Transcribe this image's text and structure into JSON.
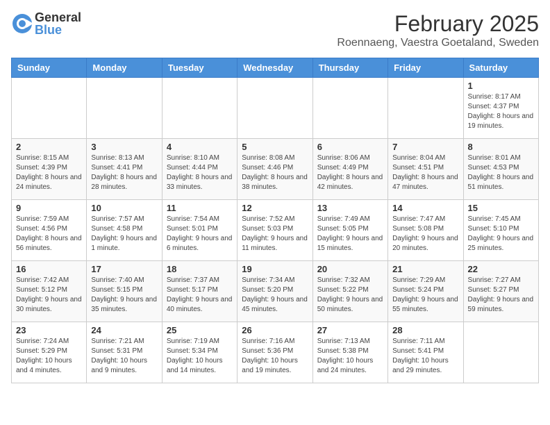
{
  "header": {
    "logo_general": "General",
    "logo_blue": "Blue",
    "month_title": "February 2025",
    "location": "Roennaeng, Vaestra Goetaland, Sweden"
  },
  "weekdays": [
    "Sunday",
    "Monday",
    "Tuesday",
    "Wednesday",
    "Thursday",
    "Friday",
    "Saturday"
  ],
  "weeks": [
    [
      {
        "day": "",
        "info": ""
      },
      {
        "day": "",
        "info": ""
      },
      {
        "day": "",
        "info": ""
      },
      {
        "day": "",
        "info": ""
      },
      {
        "day": "",
        "info": ""
      },
      {
        "day": "",
        "info": ""
      },
      {
        "day": "1",
        "info": "Sunrise: 8:17 AM\nSunset: 4:37 PM\nDaylight: 8 hours and 19 minutes."
      }
    ],
    [
      {
        "day": "2",
        "info": "Sunrise: 8:15 AM\nSunset: 4:39 PM\nDaylight: 8 hours and 24 minutes."
      },
      {
        "day": "3",
        "info": "Sunrise: 8:13 AM\nSunset: 4:41 PM\nDaylight: 8 hours and 28 minutes."
      },
      {
        "day": "4",
        "info": "Sunrise: 8:10 AM\nSunset: 4:44 PM\nDaylight: 8 hours and 33 minutes."
      },
      {
        "day": "5",
        "info": "Sunrise: 8:08 AM\nSunset: 4:46 PM\nDaylight: 8 hours and 38 minutes."
      },
      {
        "day": "6",
        "info": "Sunrise: 8:06 AM\nSunset: 4:49 PM\nDaylight: 8 hours and 42 minutes."
      },
      {
        "day": "7",
        "info": "Sunrise: 8:04 AM\nSunset: 4:51 PM\nDaylight: 8 hours and 47 minutes."
      },
      {
        "day": "8",
        "info": "Sunrise: 8:01 AM\nSunset: 4:53 PM\nDaylight: 8 hours and 51 minutes."
      }
    ],
    [
      {
        "day": "9",
        "info": "Sunrise: 7:59 AM\nSunset: 4:56 PM\nDaylight: 8 hours and 56 minutes."
      },
      {
        "day": "10",
        "info": "Sunrise: 7:57 AM\nSunset: 4:58 PM\nDaylight: 9 hours and 1 minute."
      },
      {
        "day": "11",
        "info": "Sunrise: 7:54 AM\nSunset: 5:01 PM\nDaylight: 9 hours and 6 minutes."
      },
      {
        "day": "12",
        "info": "Sunrise: 7:52 AM\nSunset: 5:03 PM\nDaylight: 9 hours and 11 minutes."
      },
      {
        "day": "13",
        "info": "Sunrise: 7:49 AM\nSunset: 5:05 PM\nDaylight: 9 hours and 15 minutes."
      },
      {
        "day": "14",
        "info": "Sunrise: 7:47 AM\nSunset: 5:08 PM\nDaylight: 9 hours and 20 minutes."
      },
      {
        "day": "15",
        "info": "Sunrise: 7:45 AM\nSunset: 5:10 PM\nDaylight: 9 hours and 25 minutes."
      }
    ],
    [
      {
        "day": "16",
        "info": "Sunrise: 7:42 AM\nSunset: 5:12 PM\nDaylight: 9 hours and 30 minutes."
      },
      {
        "day": "17",
        "info": "Sunrise: 7:40 AM\nSunset: 5:15 PM\nDaylight: 9 hours and 35 minutes."
      },
      {
        "day": "18",
        "info": "Sunrise: 7:37 AM\nSunset: 5:17 PM\nDaylight: 9 hours and 40 minutes."
      },
      {
        "day": "19",
        "info": "Sunrise: 7:34 AM\nSunset: 5:20 PM\nDaylight: 9 hours and 45 minutes."
      },
      {
        "day": "20",
        "info": "Sunrise: 7:32 AM\nSunset: 5:22 PM\nDaylight: 9 hours and 50 minutes."
      },
      {
        "day": "21",
        "info": "Sunrise: 7:29 AM\nSunset: 5:24 PM\nDaylight: 9 hours and 55 minutes."
      },
      {
        "day": "22",
        "info": "Sunrise: 7:27 AM\nSunset: 5:27 PM\nDaylight: 9 hours and 59 minutes."
      }
    ],
    [
      {
        "day": "23",
        "info": "Sunrise: 7:24 AM\nSunset: 5:29 PM\nDaylight: 10 hours and 4 minutes."
      },
      {
        "day": "24",
        "info": "Sunrise: 7:21 AM\nSunset: 5:31 PM\nDaylight: 10 hours and 9 minutes."
      },
      {
        "day": "25",
        "info": "Sunrise: 7:19 AM\nSunset: 5:34 PM\nDaylight: 10 hours and 14 minutes."
      },
      {
        "day": "26",
        "info": "Sunrise: 7:16 AM\nSunset: 5:36 PM\nDaylight: 10 hours and 19 minutes."
      },
      {
        "day": "27",
        "info": "Sunrise: 7:13 AM\nSunset: 5:38 PM\nDaylight: 10 hours and 24 minutes."
      },
      {
        "day": "28",
        "info": "Sunrise: 7:11 AM\nSunset: 5:41 PM\nDaylight: 10 hours and 29 minutes."
      },
      {
        "day": "",
        "info": ""
      }
    ]
  ]
}
